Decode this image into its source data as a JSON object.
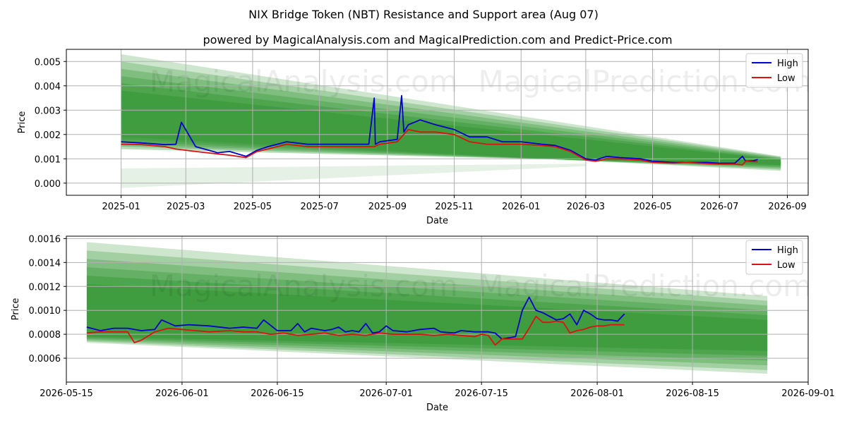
{
  "page": {
    "title": "NIX Bridge Token (NBT) Resistance and Support area (Aug 07)",
    "subtitle": "powered by MagicalAnalysis.com and MagicalPrediction.com and Predict-Price.com"
  },
  "watermarks": [
    "MagicalAnalysis.com",
    "MagicalPrediction.com"
  ],
  "colors": {
    "high": "#0000cc",
    "low": "#dd1111",
    "band": "#1e8c1e"
  },
  "chart_data": [
    {
      "type": "line",
      "xlabel": "Date",
      "ylabel": "Price",
      "x_ticks": [
        "2025-01",
        "2025-03",
        "2025-05",
        "2025-07",
        "2025-09",
        "2025-11",
        "2026-01",
        "2026-03",
        "2026-05",
        "2026-07",
        "2026-09"
      ],
      "y_ticks": [
        "0.000",
        "0.001",
        "0.002",
        "0.003",
        "0.004",
        "0.005"
      ],
      "ylim": [
        -0.0005,
        0.0055
      ],
      "xlim": [
        "2024-11-12",
        "2026-09-20"
      ],
      "grid": true,
      "legend": "top-right",
      "bands": {
        "x": [
          "2025-01-01",
          "2026-08-26"
        ],
        "upper_start": [
          0.0053,
          0.005,
          0.0047,
          0.0044,
          0.0041,
          0.0038
        ],
        "upper_end": [
          0.0011,
          0.00108,
          0.00105,
          0.00102,
          0.00099,
          0.00096
        ],
        "lower_start": [
          0.0019,
          0.0018,
          0.0017,
          0.0016,
          0.0015,
          0.0014
        ],
        "lower_end": [
          0.0005,
          0.00055,
          0.0006,
          0.00065,
          0.0007,
          0.00075
        ],
        "support_band": {
          "x": [
            "2025-01-01",
            "2026-03-01"
          ],
          "upper": [
            0.0006,
            0.0008
          ],
          "lower": [
            -0.0002,
            0.0007
          ]
        }
      },
      "series": [
        {
          "name": "High",
          "x": [
            "2025-01-01",
            "2025-01-20",
            "2025-02-10",
            "2025-02-20",
            "2025-02-25",
            "2025-03-10",
            "2025-03-30",
            "2025-04-10",
            "2025-04-25",
            "2025-05-05",
            "2025-05-15",
            "2025-06-01",
            "2025-06-20",
            "2025-07-01",
            "2025-07-15",
            "2025-08-01",
            "2025-08-15",
            "2025-08-20",
            "2025-08-21",
            "2025-08-25",
            "2025-09-10",
            "2025-09-14",
            "2025-09-16",
            "2025-09-20",
            "2025-10-01",
            "2025-10-15",
            "2025-11-01",
            "2025-11-15",
            "2025-12-01",
            "2025-12-15",
            "2026-01-01",
            "2026-01-20",
            "2026-02-01",
            "2026-02-15",
            "2026-03-01",
            "2026-03-10",
            "2026-03-20",
            "2026-04-01",
            "2026-04-20",
            "2026-05-01",
            "2026-05-20",
            "2026-06-01",
            "2026-06-20",
            "2026-07-01",
            "2026-07-15",
            "2026-07-22",
            "2026-07-25",
            "2026-08-01",
            "2026-08-05"
          ],
          "values": [
            0.0017,
            0.00165,
            0.00158,
            0.0016,
            0.0025,
            0.0015,
            0.00125,
            0.0013,
            0.0011,
            0.00135,
            0.0015,
            0.0017,
            0.0016,
            0.0016,
            0.0016,
            0.0016,
            0.0016,
            0.0035,
            0.0016,
            0.0017,
            0.0018,
            0.0036,
            0.0021,
            0.0024,
            0.0026,
            0.0024,
            0.0022,
            0.0019,
            0.0019,
            0.0017,
            0.0017,
            0.0016,
            0.00155,
            0.00135,
            0.001,
            0.00095,
            0.0011,
            0.00105,
            0.001,
            0.0009,
            0.00085,
            0.00085,
            0.00085,
            0.00082,
            0.00082,
            0.0011,
            0.0009,
            0.00092,
            0.00097
          ]
        },
        {
          "name": "Low",
          "x": [
            "2025-01-01",
            "2025-01-20",
            "2025-02-10",
            "2025-02-20",
            "2025-03-10",
            "2025-03-30",
            "2025-04-10",
            "2025-04-25",
            "2025-05-05",
            "2025-05-15",
            "2025-06-01",
            "2025-06-20",
            "2025-07-01",
            "2025-07-15",
            "2025-08-01",
            "2025-08-20",
            "2025-08-25",
            "2025-09-10",
            "2025-09-20",
            "2025-10-01",
            "2025-10-15",
            "2025-11-01",
            "2025-11-15",
            "2025-12-01",
            "2025-12-15",
            "2026-01-01",
            "2026-01-20",
            "2026-02-01",
            "2026-02-15",
            "2026-03-01",
            "2026-03-10",
            "2026-03-20",
            "2026-04-01",
            "2026-04-20",
            "2026-05-01",
            "2026-05-20",
            "2026-06-01",
            "2026-06-20",
            "2026-07-01",
            "2026-07-15",
            "2026-07-22",
            "2026-07-25",
            "2026-08-01",
            "2026-08-05"
          ],
          "values": [
            0.0016,
            0.00158,
            0.0015,
            0.0014,
            0.0013,
            0.0012,
            0.00115,
            0.00105,
            0.0013,
            0.0014,
            0.0016,
            0.0015,
            0.0015,
            0.0015,
            0.0015,
            0.0015,
            0.0016,
            0.0017,
            0.0022,
            0.0021,
            0.0021,
            0.002,
            0.0017,
            0.0016,
            0.0016,
            0.0016,
            0.00155,
            0.0015,
            0.0013,
            0.00095,
            0.0009,
            0.001,
            0.001,
            0.00095,
            0.00085,
            0.00082,
            0.00085,
            0.0008,
            0.00078,
            0.00078,
            0.00075,
            0.0009,
            0.00088,
            0.00088
          ]
        }
      ]
    },
    {
      "type": "line",
      "xlabel": "Date",
      "ylabel": "Price",
      "x_ticks": [
        "2026-05-15",
        "2026-06-01",
        "2026-06-15",
        "2026-07-01",
        "2026-07-15",
        "2026-08-01",
        "2026-08-15",
        "2026-09-01"
      ],
      "y_ticks": [
        "0.0006",
        "0.0008",
        "0.0010",
        "0.0012",
        "0.0014",
        "0.0016"
      ],
      "ylim": [
        0.0004,
        0.00162
      ],
      "xlim": [
        "2026-05-15",
        "2026-09-01"
      ],
      "grid": true,
      "legend": "top-right",
      "bands": {
        "x": [
          "2026-05-18",
          "2026-08-26"
        ],
        "upper_start": [
          0.00157,
          0.0015,
          0.00143,
          0.00136,
          0.00129,
          0.00122
        ],
        "upper_end": [
          0.00112,
          0.00108,
          0.00104,
          0.001,
          0.00096,
          0.00092
        ],
        "lower_start": [
          0.00073,
          0.00074,
          0.00075,
          0.00076,
          0.00077,
          0.00078
        ],
        "lower_end": [
          0.00047,
          0.0005,
          0.00054,
          0.00058,
          0.00062,
          0.00066
        ]
      },
      "series": [
        {
          "name": "High",
          "x": [
            "2026-05-18",
            "2026-05-20",
            "2026-05-22",
            "2026-05-24",
            "2026-05-26",
            "2026-05-28",
            "2026-05-29",
            "2026-05-31",
            "2026-06-02",
            "2026-06-05",
            "2026-06-08",
            "2026-06-10",
            "2026-06-12",
            "2026-06-13",
            "2026-06-15",
            "2026-06-16",
            "2026-06-17",
            "2026-06-18",
            "2026-06-19",
            "2026-06-20",
            "2026-06-22",
            "2026-06-23",
            "2026-06-24",
            "2026-06-25",
            "2026-06-26",
            "2026-06-27",
            "2026-06-28",
            "2026-06-29",
            "2026-06-30",
            "2026-07-01",
            "2026-07-02",
            "2026-07-04",
            "2026-07-06",
            "2026-07-08",
            "2026-07-09",
            "2026-07-11",
            "2026-07-12",
            "2026-07-14",
            "2026-07-15",
            "2026-07-16",
            "2026-07-17",
            "2026-07-18",
            "2026-07-19",
            "2026-07-20",
            "2026-07-21",
            "2026-07-22",
            "2026-07-23",
            "2026-07-24",
            "2026-07-25",
            "2026-07-26",
            "2026-07-27",
            "2026-07-28",
            "2026-07-29",
            "2026-07-30",
            "2026-07-31",
            "2026-08-01",
            "2026-08-02",
            "2026-08-03",
            "2026-08-04",
            "2026-08-05"
          ],
          "values": [
            0.00086,
            0.00083,
            0.00085,
            0.00085,
            0.00083,
            0.00084,
            0.00092,
            0.00087,
            0.00088,
            0.00087,
            0.00085,
            0.00086,
            0.00085,
            0.00092,
            0.00083,
            0.00083,
            0.00083,
            0.00089,
            0.00082,
            0.00085,
            0.00083,
            0.00084,
            0.00086,
            0.00082,
            0.00083,
            0.00082,
            0.00089,
            0.00081,
            0.00082,
            0.00087,
            0.00083,
            0.00082,
            0.00084,
            0.00085,
            0.00082,
            0.00081,
            0.00083,
            0.00082,
            0.00082,
            0.00082,
            0.00081,
            0.00076,
            0.00077,
            0.00078,
            0.001,
            0.00111,
            0.001,
            0.00098,
            0.00095,
            0.00092,
            0.00093,
            0.00097,
            0.00088,
            0.001,
            0.00097,
            0.00093,
            0.00092,
            0.00092,
            0.00091,
            0.00097
          ]
        },
        {
          "name": "Low",
          "x": [
            "2026-05-18",
            "2026-05-20",
            "2026-05-22",
            "2026-05-24",
            "2026-05-25",
            "2026-05-26",
            "2026-05-28",
            "2026-05-30",
            "2026-06-01",
            "2026-06-03",
            "2026-06-05",
            "2026-06-08",
            "2026-06-10",
            "2026-06-12",
            "2026-06-14",
            "2026-06-16",
            "2026-06-18",
            "2026-06-20",
            "2026-06-22",
            "2026-06-24",
            "2026-06-26",
            "2026-06-28",
            "2026-06-30",
            "2026-07-02",
            "2026-07-04",
            "2026-07-06",
            "2026-07-08",
            "2026-07-10",
            "2026-07-12",
            "2026-07-14",
            "2026-07-15",
            "2026-07-16",
            "2026-07-17",
            "2026-07-18",
            "2026-07-19",
            "2026-07-20",
            "2026-07-21",
            "2026-07-22",
            "2026-07-23",
            "2026-07-24",
            "2026-07-25",
            "2026-07-26",
            "2026-07-27",
            "2026-07-28",
            "2026-07-29",
            "2026-07-30",
            "2026-07-31",
            "2026-08-01",
            "2026-08-02",
            "2026-08-03",
            "2026-08-04",
            "2026-08-05"
          ],
          "values": [
            0.00081,
            0.00082,
            0.00082,
            0.00082,
            0.00073,
            0.00075,
            0.00082,
            0.00085,
            0.00084,
            0.00083,
            0.00082,
            0.00083,
            0.00082,
            0.00082,
            0.0008,
            0.00081,
            0.00079,
            0.0008,
            0.00081,
            0.00079,
            0.0008,
            0.00079,
            0.00081,
            0.0008,
            0.0008,
            0.0008,
            0.00079,
            0.0008,
            0.00079,
            0.00078,
            0.0008,
            0.00079,
            0.00071,
            0.00076,
            0.00076,
            0.00076,
            0.00076,
            0.00085,
            0.00095,
            0.0009,
            0.0009,
            0.00091,
            0.0009,
            0.00081,
            0.00083,
            0.00084,
            0.00086,
            0.00087,
            0.00087,
            0.00088,
            0.00088,
            0.00088
          ]
        }
      ]
    }
  ]
}
